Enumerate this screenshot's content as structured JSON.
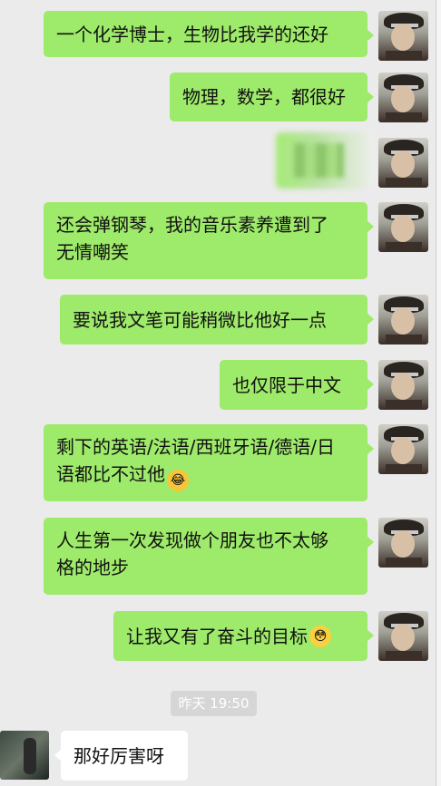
{
  "messages": [
    {
      "side": "me",
      "text": "一个化学博士，生物比我学的还好"
    },
    {
      "side": "me",
      "text": "物理，数学，都很好"
    },
    {
      "side": "me",
      "type": "blurred-image"
    },
    {
      "side": "me",
      "line1": "还会弹钢琴，我的音乐素养遭到了",
      "line2": "无情嘲笑"
    },
    {
      "side": "me",
      "text": "要说我文笔可能稍微比他好一点"
    },
    {
      "side": "me",
      "text": "也仅限于中文"
    },
    {
      "side": "me",
      "line1": "剩下的英语/法语/西班牙语/德语/日",
      "line2": "语都比不过他",
      "emoji": "laugh-cry-emoji"
    },
    {
      "side": "me",
      "line1": "人生第一次发现做个朋友也不太够",
      "line2": "格的地步"
    },
    {
      "side": "me",
      "text": "让我又有了奋斗的目标",
      "emoji": "shy-emoji"
    }
  ],
  "timestamp": "昨天 19:50",
  "reply": {
    "side": "them",
    "text": "那好厉害呀"
  },
  "colors": {
    "my_bubble": "#9eea6a",
    "their_bubble": "#ffffff",
    "background": "#ebebeb",
    "timestamp_bg": "#d6d6d6"
  },
  "icons": {
    "avatar_me": "portrait-avatar-icon",
    "avatar_them": "photo-avatar-icon"
  }
}
